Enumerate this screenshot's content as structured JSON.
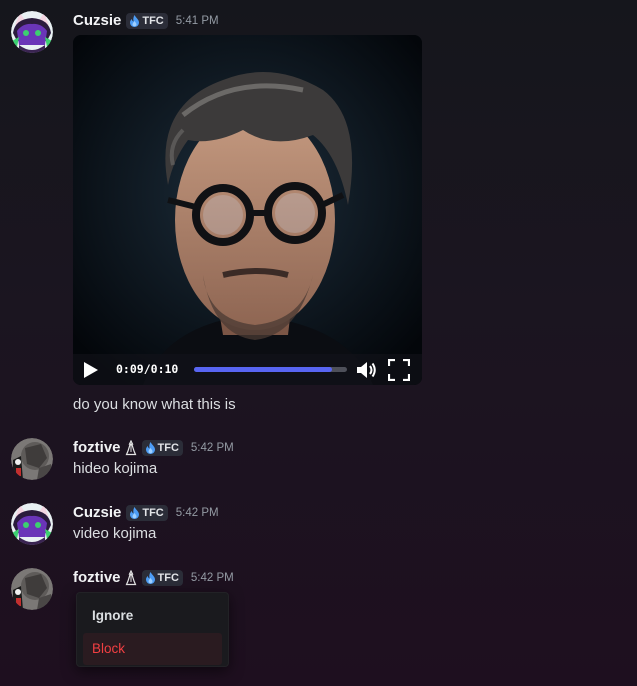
{
  "colors": {
    "accent": "#5865f2",
    "danger": "#f23f42",
    "username": "#f2f3f5",
    "timestamp": "#949ba4"
  },
  "messages": [
    {
      "author": "Cuzsie",
      "tag": "TFC",
      "tag_icon": "fire-icon",
      "time": "5:41 PM",
      "attachment": {
        "type": "video",
        "current_time": "0:09",
        "separator": "/",
        "duration": "0:10",
        "progress": 0.9
      },
      "text": "do you know what this is"
    },
    {
      "author": "foztive",
      "tag": "TFC",
      "tag_icon": "fire-icon",
      "extra_icon": "chess-bishop-icon",
      "time": "5:42 PM",
      "text": "hideo kojima"
    },
    {
      "author": "Cuzsie",
      "tag": "TFC",
      "tag_icon": "fire-icon",
      "time": "5:42 PM",
      "text": "video kojima"
    },
    {
      "author": "foztive",
      "tag": "TFC",
      "tag_icon": "fire-icon",
      "extra_icon": "chess-bishop-icon",
      "time": "5:42 PM"
    }
  ],
  "context_menu": {
    "items": [
      {
        "label": "Ignore"
      },
      {
        "label": "Block"
      }
    ]
  }
}
